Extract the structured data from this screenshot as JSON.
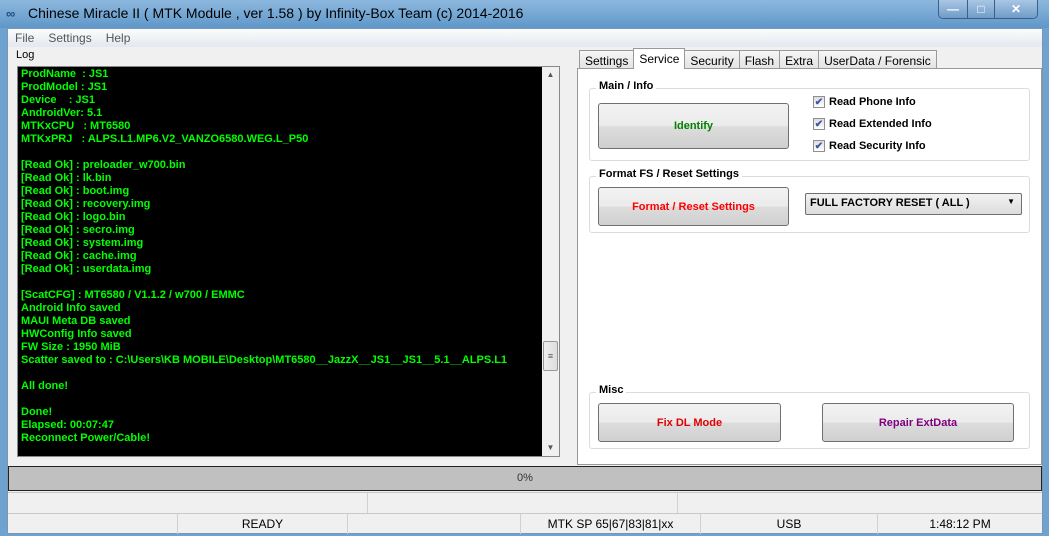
{
  "window": {
    "title": "Chinese Miracle II ( MTK Module , ver 1.58 ) by Infinity-Box Team (c) 2014-2016",
    "icon": "infinity-logo-icon",
    "minimize": "—",
    "maximize": "□",
    "close": "✕"
  },
  "menu": [
    "File",
    "Settings",
    "Help"
  ],
  "log": {
    "label": "Log",
    "text_color": "#00ff00",
    "lines": [
      "ProdName  : JS1",
      "ProdModel : JS1",
      "Device    : JS1",
      "AndroidVer: 5.1",
      "MTKxCPU   : MT6580",
      "MTKxPRJ   : ALPS.L1.MP6.V2_VANZO6580.WEG.L_P50",
      "",
      "[Read Ok] : preloader_w700.bin",
      "[Read Ok] : lk.bin",
      "[Read Ok] : boot.img",
      "[Read Ok] : recovery.img",
      "[Read Ok] : logo.bin",
      "[Read Ok] : secro.img",
      "[Read Ok] : system.img",
      "[Read Ok] : cache.img",
      "[Read Ok] : userdata.img",
      "",
      "[ScatCFG] : MT6580 / V1.1.2 / w700 / EMMC",
      "Android Info saved",
      "MAUI Meta DB saved",
      "HWConfig Info saved",
      "FW Size : 1950 MiB",
      "Scatter saved to : C:\\Users\\KB MOBILE\\Desktop\\MT6580__JazzX__JS1__JS1__5.1__ALPS.L1",
      "",
      "All done!",
      "",
      "Done!",
      "Elapsed: 00:07:47",
      "Reconnect Power/Cable!"
    ]
  },
  "tabs": [
    {
      "label": "Settings"
    },
    {
      "label": "Service",
      "active": true
    },
    {
      "label": "Security"
    },
    {
      "label": "Flash"
    },
    {
      "label": "Extra"
    },
    {
      "label": "UserData / Forensic"
    }
  ],
  "main_info": {
    "title": "Main / Info",
    "identify": "Identify",
    "identify_color": "#008000",
    "checks": [
      {
        "label": "Read Phone Info",
        "checked": true
      },
      {
        "label": "Read Extended Info",
        "checked": true
      },
      {
        "label": "Read Security Info",
        "checked": true
      }
    ]
  },
  "format": {
    "title": "Format FS / Reset Settings",
    "button": "Format / Reset Settings",
    "button_color": "#ff0000",
    "selected": "FULL FACTORY RESET ( ALL )"
  },
  "misc": {
    "title": "Misc",
    "fix_dl": "Fix DL Mode",
    "fix_dl_color": "#e00000",
    "repair": "Repair ExtData",
    "repair_color": "#800080"
  },
  "progress": {
    "percent": 0,
    "label": "0%"
  },
  "status": {
    "state": "READY",
    "protocol": "MTK SP 65|67|83|81|xx",
    "connection": "USB",
    "time": "1:48:12 PM"
  }
}
